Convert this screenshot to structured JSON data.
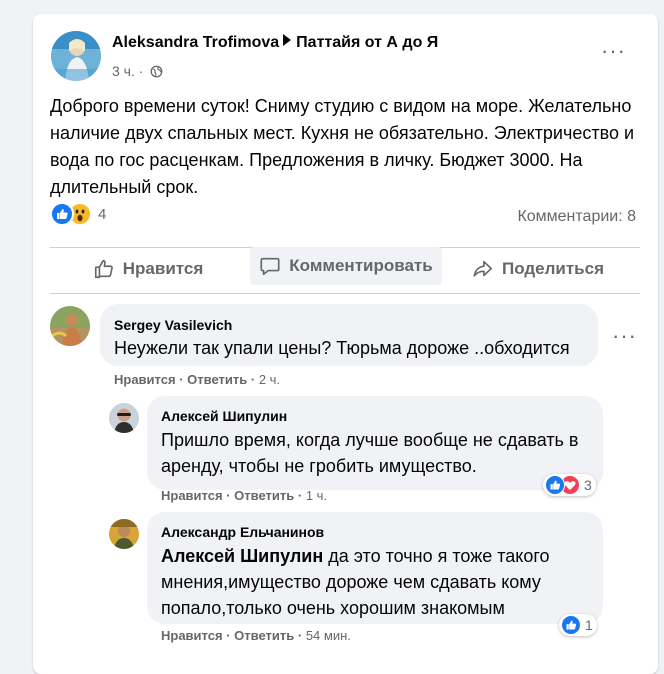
{
  "post": {
    "author": "Aleksandra Trofimova",
    "group": "Паттайя от А до Я",
    "time": "3 ч.",
    "separator": "·",
    "text": "Доброго времени суток! Сниму студию с видом на море. Желательно наличие двух спальных мест. Кухня не обязательно. Электричество и вода по гос расценкам. Предложения в личку. Бюджет 3000. На длительный срок.",
    "reaction_count": "4",
    "comments_count": "Комментарии: 8",
    "actions": {
      "like": "Нравится",
      "comment": "Комментировать",
      "share": "Поделиться"
    }
  },
  "comments": [
    {
      "name": "Sergey Vasilevich",
      "text": "Неужели так упали цены? Тюрьма дороже ..обходится",
      "like": "Нравится",
      "dot1": "·",
      "reply": "Ответить",
      "dot2": "·",
      "time": "2 ч."
    },
    {
      "name": "Алексей Шипулин",
      "text": "Пришло время, когда лучше вообще не сдавать в аренду, чтобы не гробить имущество.",
      "like": "Нравится",
      "dot1": "·",
      "reply": "Ответить",
      "dot2": "·",
      "time": "1 ч.",
      "reactions": "3"
    },
    {
      "name": "Александр Ельчанинов",
      "mention": "Алексей Шипулин",
      "text": " да это точно я тоже такого мнения,имущество дороже чем сдавать кому попало,только очень хорошим знакомым",
      "like": "Нравится",
      "dot1": "·",
      "reply": "Ответить",
      "dot2": "·",
      "time": "54 мин.",
      "reactions": "1"
    }
  ],
  "colors": {
    "like_blue": "#1877f2",
    "love_red": "#f33e58",
    "wow_yellow": "#f7b928",
    "meta_gray": "#65676b"
  },
  "icons": [
    "globe-icon",
    "more-icon",
    "like-reaction-icon",
    "wow-reaction-icon",
    "love-reaction-icon",
    "thumbs-up-icon",
    "comment-icon",
    "share-icon"
  ]
}
